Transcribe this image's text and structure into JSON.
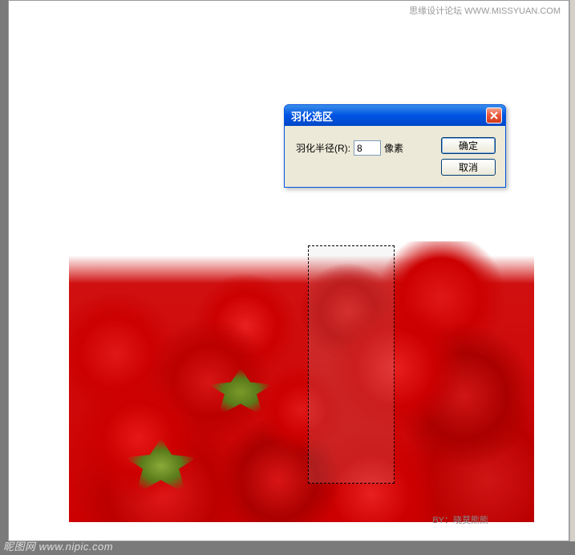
{
  "watermark": {
    "top": "思缘设计论坛  WWW.MISSYUAN.COM",
    "bottom": "昵图网 www.nipic.com",
    "credit": "BY：晓莫熊熊"
  },
  "dialog": {
    "title": "羽化选区",
    "field_label": "羽化半径(R):",
    "field_value": "8",
    "field_unit": "像素",
    "ok_label": "确定",
    "cancel_label": "取消"
  }
}
